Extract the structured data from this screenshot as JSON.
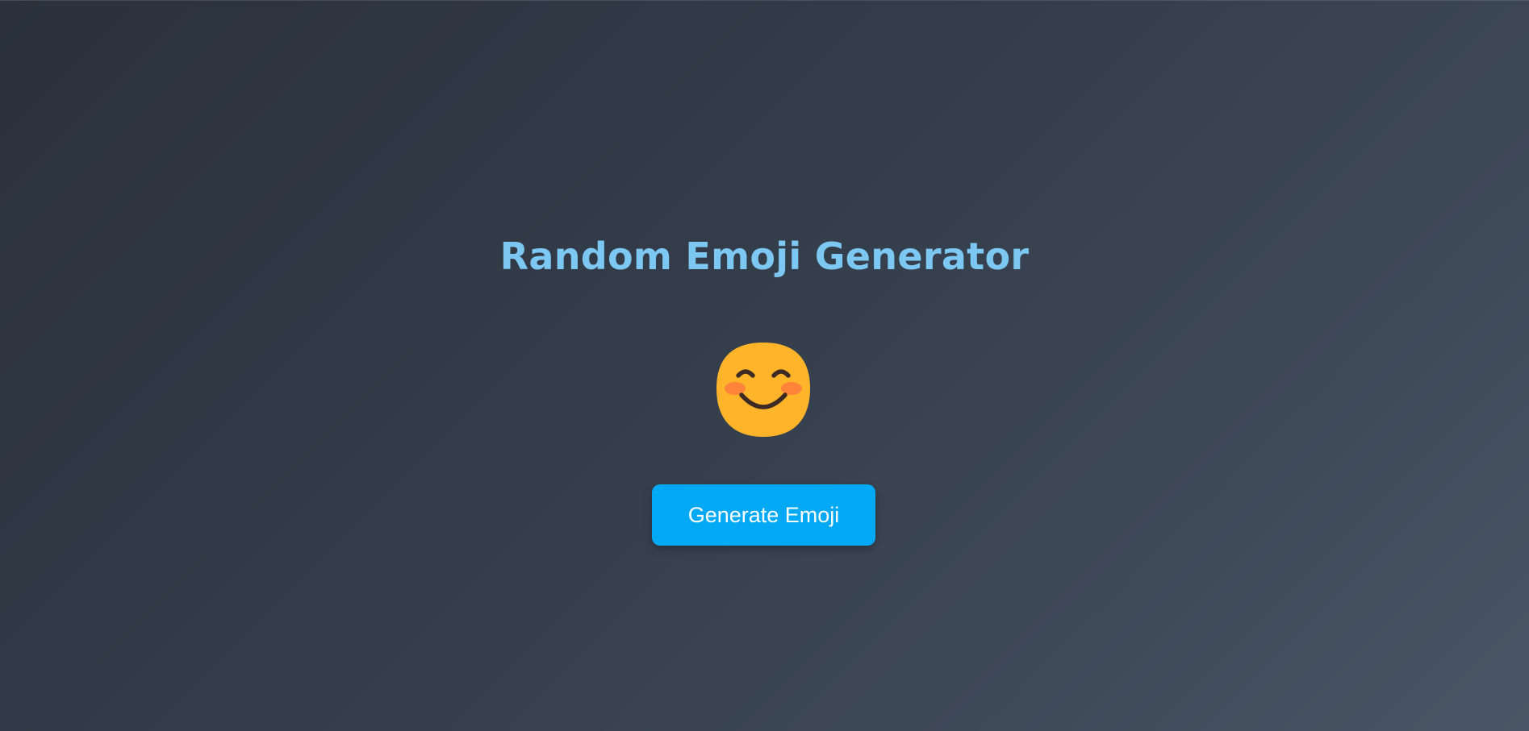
{
  "app": {
    "title": "Random Emoji Generator",
    "current_emoji": {
      "icon": "smiling-face-with-smiling-eyes-icon",
      "char": "😊"
    },
    "generate_button_label": "Generate Emoji"
  },
  "colors": {
    "title": "#7cc8f2",
    "button_bg": "#03a9f4",
    "button_text": "#ffffff",
    "background_start": "#2a313c",
    "background_end": "#4a5665",
    "emoji_face": "#ffb42a",
    "emoji_blush": "#ff7a3c",
    "emoji_features": "#3d2a24"
  }
}
